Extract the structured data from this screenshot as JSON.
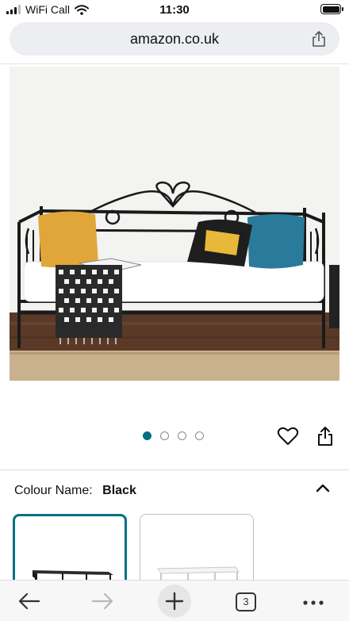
{
  "status_bar": {
    "carrier": "WiFi Call",
    "time": "11:30",
    "wifi_icon": "wifi-icon",
    "battery_icon": "battery-full-icon"
  },
  "browser": {
    "url": "amazon.co.uk",
    "share_icon": "share-icon",
    "tab_count": "3",
    "toolbar_icons": [
      "back-arrow-icon",
      "forward-arrow-icon",
      "plus-icon",
      "tabs-icon",
      "more-icon"
    ]
  },
  "gallery": {
    "image_count": 4,
    "active_index": 0,
    "active_color": "#007185"
  },
  "colour": {
    "label": "Colour Name:",
    "value": "Black",
    "options": [
      "Black",
      "White"
    ]
  },
  "colors": {
    "accent": "#007185"
  }
}
